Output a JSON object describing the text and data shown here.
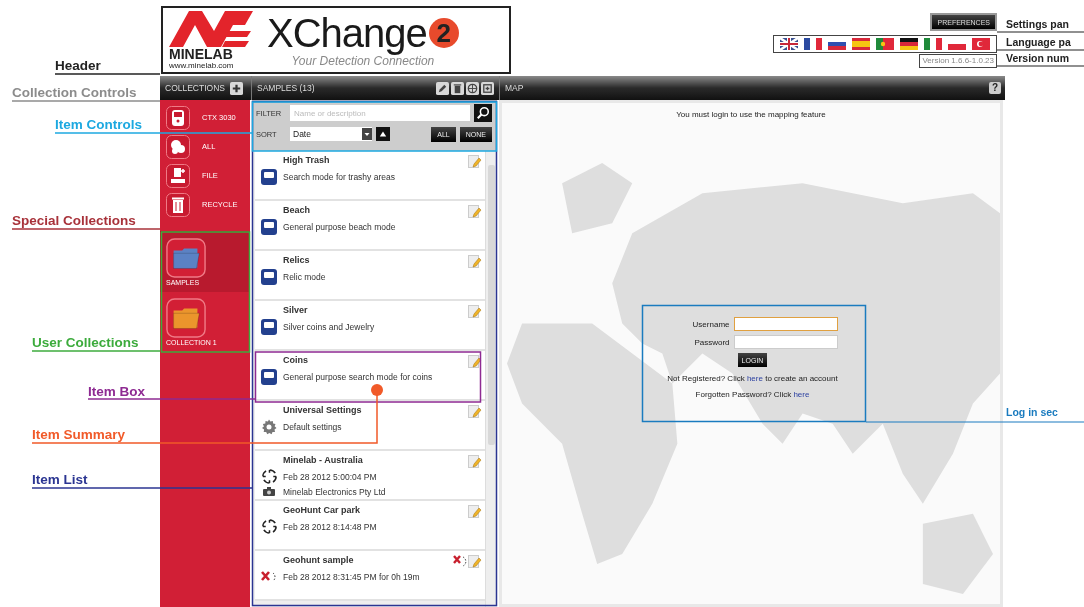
{
  "annotations_left": [
    {
      "text": "Header",
      "color": "#222222"
    },
    {
      "text": "Collection Controls",
      "color": "#8c8c8c"
    },
    {
      "text": "Item Controls",
      "color": "#1ca8e0"
    },
    {
      "text": "Special Collections",
      "color": "#a8323a"
    },
    {
      "text": "User Collections",
      "color": "#3cab3c"
    },
    {
      "text": "Item Box",
      "color": "#8e2a92"
    },
    {
      "text": "Item Summary",
      "color": "#f15a29"
    },
    {
      "text": "Item List",
      "color": "#2b3592"
    }
  ],
  "annotations_right": [
    {
      "text": "Settings pan",
      "color": "#222222"
    },
    {
      "text": "Language pa",
      "color": "#222222"
    },
    {
      "text": "Version num",
      "color": "#222222"
    },
    {
      "text": "Log in sec",
      "color": "#1a7bbf"
    }
  ],
  "header": {
    "brand": "MINELAB",
    "brand_url": "www.minelab.com",
    "product": "XChange",
    "product_mark": "2",
    "tagline": "Your Detection Connection",
    "preferences_button": "PREFERENCES",
    "version": "Version 1.6.6-1.0.23"
  },
  "toolbar": {
    "collections": "COLLECTIONS",
    "samples": "SAMPLES (13)",
    "map": "MAP",
    "help": "?"
  },
  "special_collections": [
    {
      "label": "CTX 3030",
      "kind": "device"
    },
    {
      "label": "ALL",
      "kind": "all"
    },
    {
      "label": "FILE",
      "kind": "file"
    },
    {
      "label": "RECYCLE",
      "kind": "recycle"
    }
  ],
  "user_collections": [
    {
      "label": "SAMPLES",
      "color": "#5b82c4",
      "selected": true
    },
    {
      "label": "COLLECTION 1",
      "color": "#eb952c",
      "selected": false
    }
  ],
  "filter": {
    "label": "FILTER",
    "placeholder": "Name or description",
    "sort_label": "SORT",
    "sort_value": "Date",
    "all_button": "ALL",
    "none_button": "NONE"
  },
  "items": [
    {
      "kind": "mode",
      "title": "High Trash",
      "lines": [
        "Search mode for trashy areas"
      ],
      "photo": false
    },
    {
      "kind": "mode",
      "title": "Beach",
      "lines": [
        "General purpose beach mode"
      ],
      "photo": false
    },
    {
      "kind": "mode",
      "title": "Relics",
      "lines": [
        "Relic mode"
      ],
      "photo": false
    },
    {
      "kind": "mode",
      "title": "Silver",
      "lines": [
        "Silver coins and Jewelry"
      ],
      "photo": false
    },
    {
      "kind": "mode",
      "title": "Coins",
      "lines": [
        "General purpose search mode for coins"
      ],
      "photo": false
    },
    {
      "kind": "settings",
      "title": "Universal Settings",
      "lines": [
        "Default settings"
      ],
      "photo": false
    },
    {
      "kind": "location",
      "title": "Minelab - Australia",
      "lines": [
        "Feb 28 2012 5:00:04 PM",
        "Minelab Electronics Pty Ltd"
      ],
      "photo": true
    },
    {
      "kind": "location",
      "title": "GeoHunt Car park",
      "lines": [
        "Feb 28 2012 8:14:48 PM"
      ],
      "photo": false
    },
    {
      "kind": "track",
      "title": "Geohunt sample",
      "lines": [
        "Feb 28 2012 8:31:45 PM for 0h 19m"
      ],
      "photo": false
    }
  ],
  "map": {
    "notice": "You must login to use the mapping feature",
    "username_label": "Username",
    "password_label": "Password",
    "login_button": "LOGIN",
    "register": {
      "before": "Not Registered? Click ",
      "link": "here",
      "after": " to create an account"
    },
    "forgot": {
      "before": "Forgotten Password? Click ",
      "link": "here"
    }
  }
}
